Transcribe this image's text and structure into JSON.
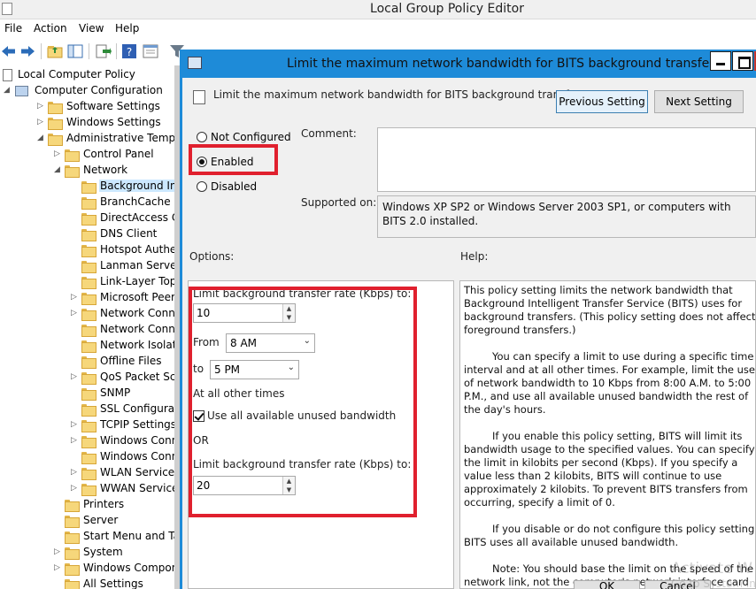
{
  "app": {
    "title": "Local Group Policy Editor"
  },
  "menu": [
    "File",
    "Action",
    "View",
    "Help"
  ],
  "toolbar": {
    "icons": [
      "back-arrow-icon",
      "forward-arrow-icon",
      "up-folder-icon",
      "show-hide-tree-icon",
      "export-list-icon",
      "help-icon",
      "properties-icon",
      "filter-icon"
    ]
  },
  "tree": {
    "root": "Local Computer Policy",
    "computer_config": "Computer Configuration",
    "items": [
      "Software Settings",
      "Windows Settings",
      "Administrative Templates",
      "Control Panel",
      "Network",
      "Background Intellig",
      "BranchCache",
      "DirectAccess Client",
      "DNS Client",
      "Hotspot Authentica",
      "Lanman Server",
      "Link-Layer Topolog",
      "Microsoft Peer-to-P",
      "Network Connectio",
      "Network Connectiv",
      "Network Isolation",
      "Offline Files",
      "QoS Packet Schedu",
      "SNMP",
      "SSL Configuration S",
      "TCPIP Settings",
      "Windows Connect",
      "Windows Connecti",
      "WLAN Service",
      "WWAN Service",
      "Printers",
      "Server",
      "Start Menu and Taskba",
      "System",
      "Windows Components",
      "All Settings"
    ]
  },
  "dialog": {
    "title": "Limit the maximum network bandwidth for BITS background transfers",
    "policy_name": "Limit the maximum network bandwidth for BITS background transfers",
    "previous_setting": "Previous Setting",
    "next_setting": "Next Setting",
    "state": {
      "not_configured": "Not Configured",
      "enabled": "Enabled",
      "disabled": "Disabled",
      "selected": "Enabled"
    },
    "comment_label": "Comment:",
    "comment_value": "",
    "supported_label": "Supported on:",
    "supported_value": "Windows XP SP2 or Windows Server 2003 SP1, or computers with BITS 2.0 installed.",
    "options_label": "Options:",
    "help_label": "Help:",
    "options": {
      "limit_label": "Limit background transfer rate (Kbps) to:",
      "limit_value": "10",
      "from_label": "From",
      "from_value": "8 AM",
      "to_label": "to",
      "to_value": "5 PM",
      "other_times_label": "At all other times",
      "use_all_label": "Use all available unused bandwidth",
      "use_all_checked": true,
      "or_label": "OR",
      "limit2_label": "Limit background transfer rate (Kbps) to:",
      "limit2_value": "20"
    },
    "help": [
      "This policy setting limits the network bandwidth that Background Intelligent Transfer Service (BITS) uses for background transfers. (This policy setting does not affect foreground transfers.)",
      "You can specify a limit to use during a specific time interval and at all other times. For example, limit the use of network bandwidth to 10 Kbps from 8:00 A.M. to 5:00 P.M., and use all available unused bandwidth the rest of the day's hours.",
      "If you enable this policy setting, BITS will limit its bandwidth usage to the specified values. You can specify the limit in kilobits per second (Kbps). If you specify a value less than 2 kilobits, BITS will continue to use approximately 2 kilobits. To prevent BITS transfers from occurring, specify a limit of 0.",
      "If you disable or do not configure this policy setting, BITS uses all available unused bandwidth.",
      "Note: You should base the limit on the speed of the network link, not the computer's network interface card (NIC)."
    ],
    "ok_label": "OK",
    "cancel_label": "Cancel"
  },
  "watermark": {
    "line1": "Activate W",
    "line2": "Go to System in"
  },
  "colors": {
    "dialog_titlebar": "#1e8bd8",
    "highlight_box": "#e0202e",
    "selection": "#cce8ff"
  }
}
